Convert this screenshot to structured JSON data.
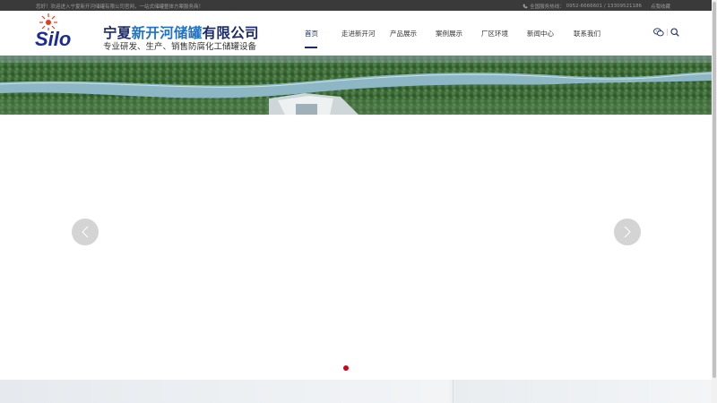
{
  "topbar": {
    "welcome": "您好！欢迎进入宁夏新开河储罐有限公司官网，一站式储罐整体方案服务商！",
    "hotline_label": "全国服务热线：",
    "hotline_numbers": "0952-6666601 / 13309521186",
    "favorite": "点我收藏"
  },
  "header": {
    "logo_text": "Silo",
    "company_prefix": "宁夏",
    "company_highlight": "新开河储罐",
    "company_suffix": "有限公司",
    "slogan": "专业研发、生产、销售防腐化工储罐设备"
  },
  "nav": {
    "items": [
      {
        "label": "首页"
      },
      {
        "label": "走进新开河"
      },
      {
        "label": "产品展示"
      },
      {
        "label": "案例展示"
      },
      {
        "label": "厂区环境"
      },
      {
        "label": "新闻中心"
      },
      {
        "label": "联系我们"
      }
    ],
    "active_index": 0
  },
  "icons": {
    "wechat": "wechat-icon",
    "search": "search-icon"
  },
  "slider": {
    "slide_count": 1,
    "active_slide": 0
  },
  "colors": {
    "brand_navy": "#1a2a6c",
    "brand_blue": "#1e73c8",
    "dot_active": "#d0021b",
    "topbar_bg": "#3a3a3a"
  }
}
